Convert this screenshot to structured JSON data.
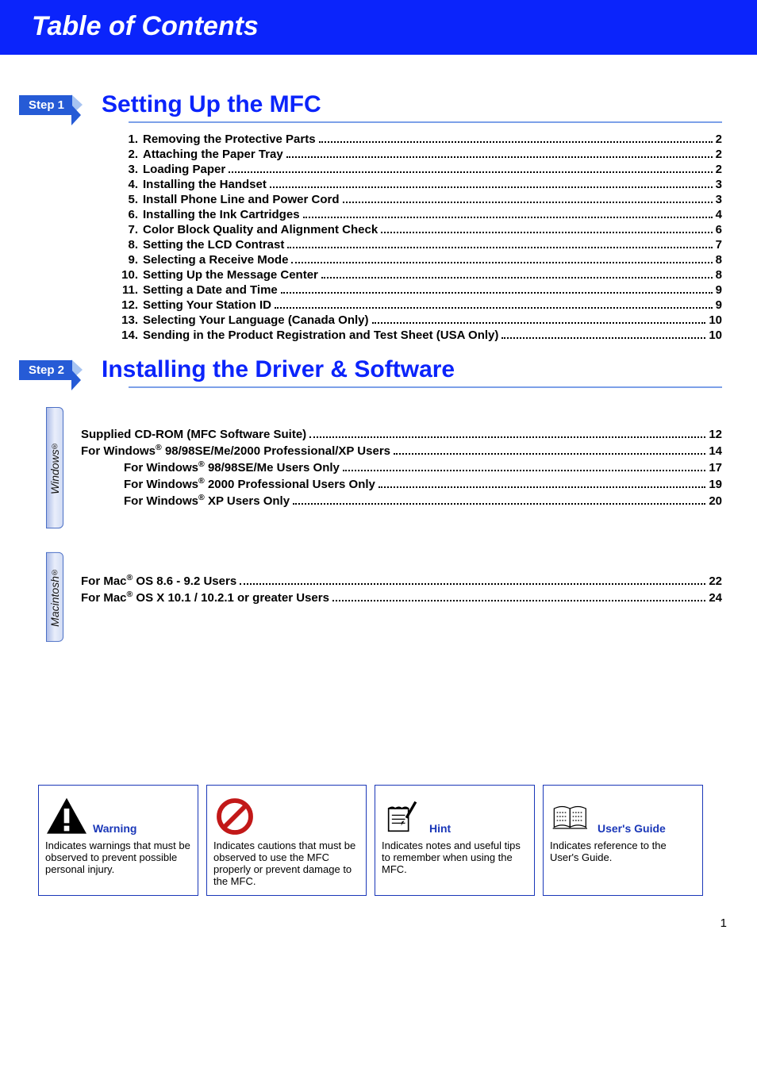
{
  "banner": "Table of Contents",
  "steps": [
    {
      "badge": "Step 1",
      "title": "Setting Up the MFC"
    },
    {
      "badge": "Step 2",
      "title": "Installing the Driver & Software"
    }
  ],
  "toc1": [
    {
      "n": "1.",
      "t": "Removing the Protective Parts",
      "p": "2"
    },
    {
      "n": "2.",
      "t": "Attaching the Paper Tray",
      "p": "2"
    },
    {
      "n": "3.",
      "t": "Loading Paper",
      "p": "2"
    },
    {
      "n": "4.",
      "t": "Installing the Handset",
      "p": "3"
    },
    {
      "n": "5.",
      "t": "Install Phone Line and Power Cord",
      "p": "3"
    },
    {
      "n": "6.",
      "t": "Installing the Ink Cartridges",
      "p": "4"
    },
    {
      "n": "7.",
      "t": "Color Block Quality and Alignment Check",
      "p": "6"
    },
    {
      "n": "8.",
      "t": "Setting the LCD Contrast",
      "p": "7"
    },
    {
      "n": "9.",
      "t": "Selecting a Receive Mode",
      "p": "8"
    },
    {
      "n": "10.",
      "t": "Setting Up the Message Center",
      "p": "8"
    },
    {
      "n": "11.",
      "t": "Setting a Date and Time",
      "p": "9"
    },
    {
      "n": "12.",
      "t": "Setting Your Station ID",
      "p": "9"
    },
    {
      "n": "13.",
      "t": "Selecting Your Language (Canada Only)",
      "p": "10"
    },
    {
      "n": "14.",
      "t": "Sending in the Product Registration and Test Sheet (USA Only)",
      "p": "10"
    }
  ],
  "windows_tab": "Windows",
  "windows_list": [
    {
      "t_html": "Supplied CD-ROM (MFC Software Suite)",
      "p": "12",
      "sub": false
    },
    {
      "t_html": "For Windows<sup>®</sup> 98/98SE/Me/2000 Professional/XP Users",
      "p": "14",
      "sub": false
    },
    {
      "t_html": "For Windows<sup>®</sup> 98/98SE/Me Users Only",
      "p": "17",
      "sub": true
    },
    {
      "t_html": "For Windows<sup>®</sup> 2000 Professional Users Only",
      "p": "19",
      "sub": true
    },
    {
      "t_html": "For Windows<sup>®</sup> XP Users Only",
      "p": "20",
      "sub": true
    }
  ],
  "mac_tab": "Macintosh",
  "mac_list": [
    {
      "t_html": "For Mac<sup>®</sup> OS 8.6 - 9.2 Users",
      "p": "22"
    },
    {
      "t_html": "For Mac<sup>®</sup> OS X 10.1 / 10.2.1 or greater Users",
      "p": "24"
    }
  ],
  "legend": [
    {
      "title": "Warning",
      "desc": "Indicates warnings that must be observed to prevent possible personal injury.",
      "icon": "warning-icon"
    },
    {
      "title": "",
      "desc": "Indicates cautions that must be observed to use the MFC properly or prevent damage to the MFC.",
      "icon": "prohibit-icon"
    },
    {
      "title": "Hint",
      "desc": "Indicates notes and useful tips to remember when using the MFC.",
      "icon": "note-icon"
    },
    {
      "title": "User's Guide",
      "desc": "Indicates reference to the User's Guide.",
      "icon": "book-icon"
    }
  ],
  "page_number": "1"
}
